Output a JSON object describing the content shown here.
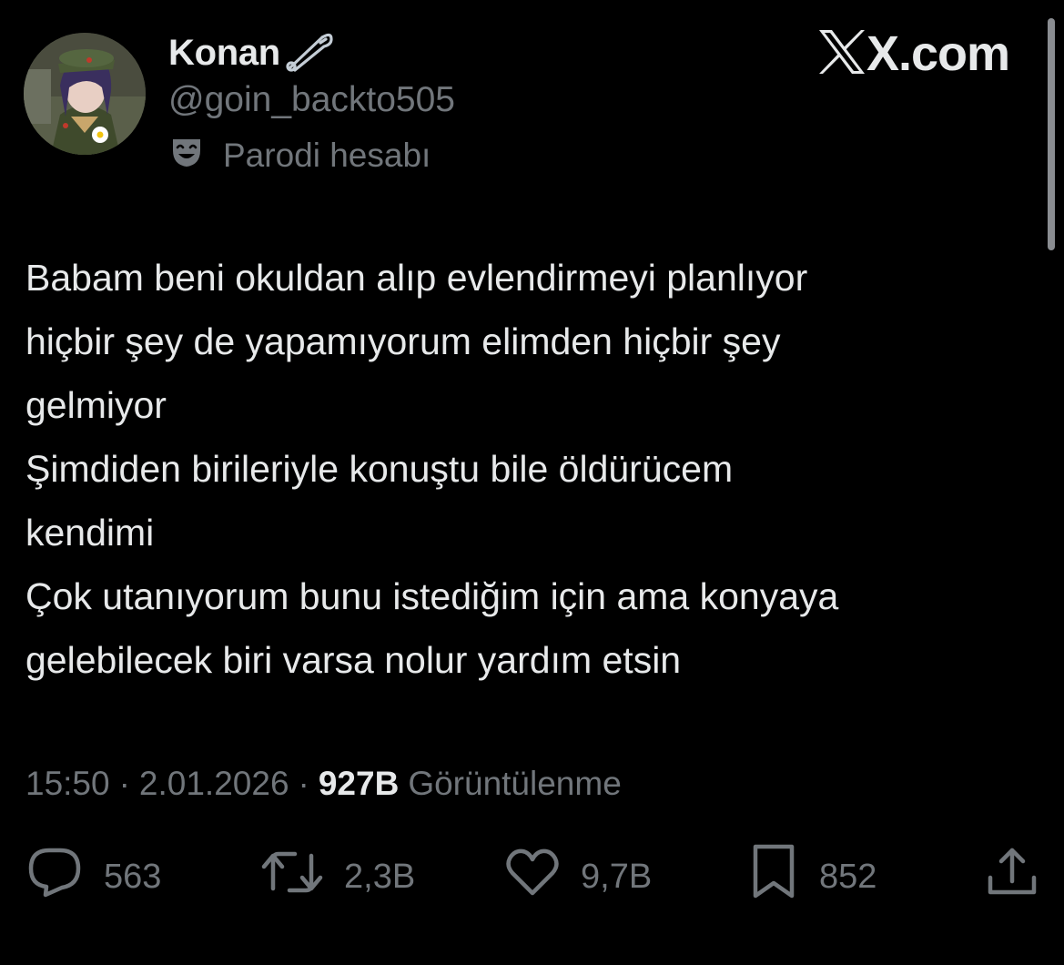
{
  "user": {
    "display_name": "Konan",
    "handle": "@goin_backto505",
    "badge_icon": "safety-pin-icon",
    "label_icon": "parody-mask-icon",
    "label": "Parodi hesabı"
  },
  "brand": {
    "text": "X.com"
  },
  "tweet": {
    "lines": [
      "Babam beni okuldan alıp evlendirmeyi planlıyor",
      "hiçbir şey de yapamıyorum elimden hiçbir şey",
      "gelmiyor",
      "Şimdiden birileriyle konuştu bile öldürücem",
      "kendimi",
      "Çok utanıyorum bunu istediğim için ama konyaya",
      "gelebilecek biri varsa nolur yardım etsin"
    ]
  },
  "meta": {
    "time": "15:50",
    "separator": "·",
    "date": "2.01.2026",
    "views": "927B",
    "views_label": "Görüntülenme"
  },
  "actions": {
    "replies": {
      "icon": "reply-icon",
      "count": "563"
    },
    "reposts": {
      "icon": "repost-icon",
      "count": "2,3B"
    },
    "likes": {
      "icon": "heart-icon",
      "count": "9,7B"
    },
    "bookmarks": {
      "icon": "bookmark-icon",
      "count": "852"
    },
    "share": {
      "icon": "share-icon"
    }
  },
  "colors": {
    "background": "#000000",
    "primary_text": "#e7e9ea",
    "secondary_text": "#71767b"
  }
}
